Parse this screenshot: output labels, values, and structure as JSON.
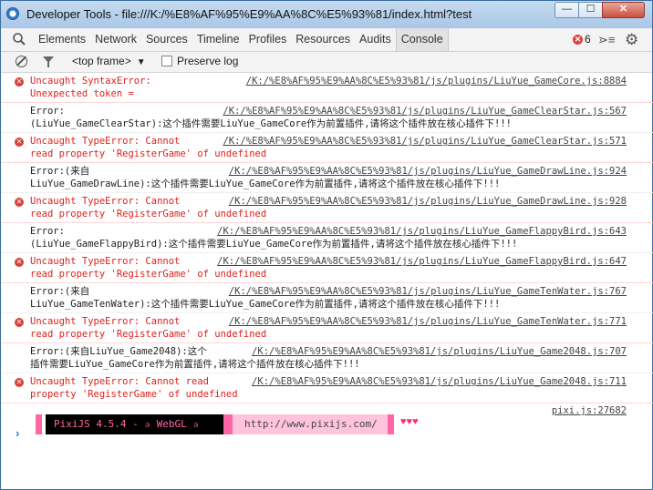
{
  "window": {
    "title": "Developer Tools - file:///K:/%E8%AF%95%E9%AA%8C%E5%93%81/index.html?test",
    "min": "—",
    "max": "☐",
    "close": "✕"
  },
  "tabs": [
    "Elements",
    "Network",
    "Sources",
    "Timeline",
    "Profiles",
    "Resources",
    "Audits",
    "Console"
  ],
  "active_tab": "Console",
  "error_count": "6",
  "toolbar": {
    "frame": "<top frame>",
    "preserve_log": "Preserve log"
  },
  "messages": [
    {
      "type": "error",
      "text": "Uncaught SyntaxError:\nUnexpected token =",
      "src": "/K:/%E8%AF%95%E9%AA%8C%E5%93%81/js/plugins/LiuYue_GameCore.js:8884"
    },
    {
      "type": "log",
      "text": "Error:\n(LiuYue_GameClearStar):这个插件需要LiuYue_GameCore作为前置插件,请将这个插件放在核心插件下!!!",
      "src": "/K:/%E8%AF%95%E9%AA%8C%E5%93%81/js/plugins/LiuYue_GameClearStar.js:567"
    },
    {
      "type": "error",
      "text": "Uncaught TypeError: Cannot\nread property 'RegisterGame' of undefined",
      "src": "/K:/%E8%AF%95%E9%AA%8C%E5%93%81/js/plugins/LiuYue_GameClearStar.js:571"
    },
    {
      "type": "log",
      "text": "Error:(来自\nLiuYue_GameDrawLine):这个插件需要LiuYue_GameCore作为前置插件,请将这个插件放在核心插件下!!!",
      "src": "/K:/%E8%AF%95%E9%AA%8C%E5%93%81/js/plugins/LiuYue_GameDrawLine.js:924"
    },
    {
      "type": "error",
      "text": "Uncaught TypeError: Cannot\nread property 'RegisterGame' of undefined",
      "src": "/K:/%E8%AF%95%E9%AA%8C%E5%93%81/js/plugins/LiuYue_GameDrawLine.js:928"
    },
    {
      "type": "log",
      "text": "Error:\n(LiuYue_GameFlappyBird):这个插件需要LiuYue_GameCore作为前置插件,请将这个插件放在核心插件下!!!",
      "src": "/K:/%E8%AF%95%E9%AA%8C%E5%93%81/js/plugins/LiuYue_GameFlappyBird.js:643"
    },
    {
      "type": "error",
      "text": "Uncaught TypeError: Cannot\nread property 'RegisterGame' of undefined",
      "src": "/K:/%E8%AF%95%E9%AA%8C%E5%93%81/js/plugins/LiuYue_GameFlappyBird.js:647"
    },
    {
      "type": "log",
      "text": "Error:(来自\nLiuYue_GameTenWater):这个插件需要LiuYue_GameCore作为前置插件,请将这个插件放在核心插件下!!!",
      "src": "/K:/%E8%AF%95%E9%AA%8C%E5%93%81/js/plugins/LiuYue_GameTenWater.js:767"
    },
    {
      "type": "error",
      "text": "Uncaught TypeError: Cannot\nread property 'RegisterGame' of undefined",
      "src": "/K:/%E8%AF%95%E9%AA%8C%E5%93%81/js/plugins/LiuYue_GameTenWater.js:771"
    },
    {
      "type": "log",
      "text": "Error:(来自LiuYue_Game2048):这个\n插件需要LiuYue_GameCore作为前置插件,请将这个插件放在核心插件下!!!",
      "src": "/K:/%E8%AF%95%E9%AA%8C%E5%93%81/js/plugins/LiuYue_Game2048.js:707"
    },
    {
      "type": "error",
      "text": "Uncaught TypeError: Cannot read\nproperty 'RegisterGame' of undefined",
      "src": "/K:/%E8%AF%95%E9%AA%8C%E5%93%81/js/plugins/LiuYue_Game2048.js:711"
    }
  ],
  "banner": {
    "src": "pixi.js:27682",
    "label": "PixiJS 4.5.4 - ✰ WebGL ✰",
    "url": "http://www.pixijs.com/",
    "hearts": "♥♥♥"
  },
  "prompt": "›"
}
